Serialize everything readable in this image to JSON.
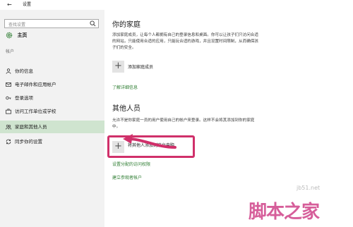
{
  "window": {
    "back_glyph": "←",
    "title": "设置"
  },
  "sidebar": {
    "search_placeholder": "查找设置",
    "home_label": "主页",
    "section_label": "帐户",
    "items": [
      {
        "label": "你的信息",
        "icon": "person-icon"
      },
      {
        "label": "电子邮件和应用帐户",
        "icon": "mail-icon"
      },
      {
        "label": "登录选项",
        "icon": "key-icon"
      },
      {
        "label": "访问工作单位或学校",
        "icon": "briefcase-icon"
      },
      {
        "label": "家庭和其他人员",
        "icon": "people-icon",
        "active": true
      },
      {
        "label": "同步你的设置",
        "icon": "sync-icon"
      }
    ]
  },
  "main": {
    "family": {
      "heading": "你的家庭",
      "description": "添加家庭成员，让每个人都拥有自己的登录信息和桌面。你可以让孩子们只访问合适的网站，只能使用合适的应用，只能玩合适的游戏，并且设置时间限制，从而确保孩子们的安全。",
      "add_label": "添加家庭成员",
      "learn_more": "了解详细信息"
    },
    "others": {
      "heading": "其他人员",
      "description": "允许不是你家庭一员的用户使用自己的帐户来登录。这样不会将其添加到你的家庭中。",
      "add_label": "将其他人添加到这台电脑",
      "link_access": "设置分配的访问权限",
      "link_kiosk": "建立参观者帐户"
    }
  },
  "watermark": {
    "small": "jb51.net",
    "big": "脚本之家"
  },
  "colors": {
    "accent": "#2e7d32",
    "active_bg": "#cfe4cf",
    "highlight": "#d0306a"
  }
}
